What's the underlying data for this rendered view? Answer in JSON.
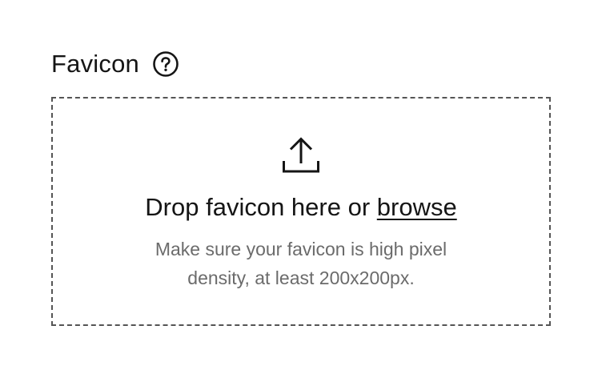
{
  "field": {
    "label": "Favicon",
    "help_icon": "question-circle-icon"
  },
  "dropzone": {
    "icon": "upload-icon",
    "headline_prefix": "Drop favicon here or ",
    "browse_label": "browse",
    "hint": "Make sure your favicon is high pixel density, at least 200x200px."
  },
  "colors": {
    "text": "#151515",
    "muted": "#6b6b6b",
    "border": "#555555"
  }
}
